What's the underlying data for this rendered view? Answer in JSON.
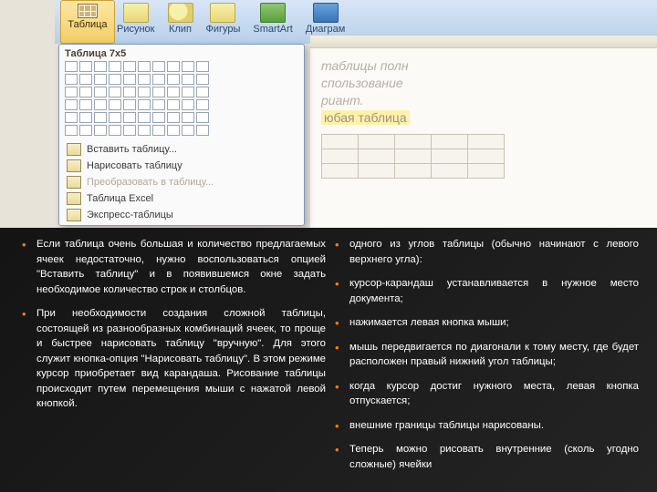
{
  "ribbon": {
    "table_button": "Таблица",
    "items": [
      "Рисунок",
      "Клип",
      "Фигуры",
      "SmartArt",
      "Диаграм"
    ]
  },
  "dropdown": {
    "title": "Таблица 7x5",
    "rows": [
      "Вставить таблицу...",
      "Нарисовать таблицу",
      "Преобразовать в таблицу...",
      "Таблица Excel",
      "Экспресс-таблицы"
    ]
  },
  "insert_doc": {
    "line1": "таблицы полн",
    "line2": "спользование",
    "line3": "риант.",
    "hl": "юбая таблица"
  },
  "left_points": [
    "Если таблица очень большая и количество предлагаемых ячеек недостаточно, нужно воспользоваться опцией \"Вставить таблицу\" и в появившемся окне задать необходимое количество строк и столбцов.",
    "При необходимости создания сложной таблицы, состоящей из разнообразных комбинаций ячеек, то проще и быстрее нарисовать таблицу \"вручную\". Для этого служит кнопка-опция \"Нарисовать таблицу\". В этом режиме курсор приобретает вид карандаша. Рисование таблицы происходит путем перемещения мыши с нажатой левой кнопкой."
  ],
  "right_points": [
    "одного из углов таблицы (обычно начинают с левого верхнего угла):",
    "курсор-карандаш устанавливается в нужное место документа;",
    "нажимается левая кнопка мыши;",
    "мышь передвигается по диагонали к тому месту, где будет расположен правый нижний угол таблицы;",
    "когда курсор достиг нужного места, левая кнопка отпускается;",
    "внешние границы таблицы нарисованы.",
    "Теперь можно рисовать внутренние (сколь угодно сложные) ячейки"
  ]
}
